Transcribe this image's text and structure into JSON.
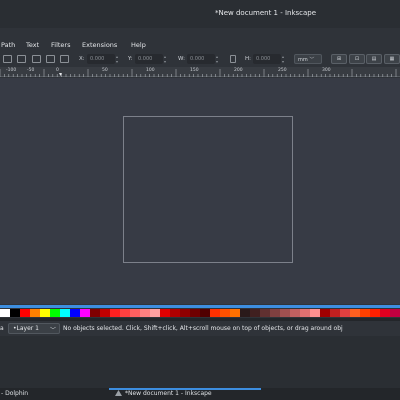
{
  "window": {
    "title": "*New document 1 - Inkscape"
  },
  "menu": {
    "items": [
      "Path",
      "Text",
      "Filters",
      "Extensions",
      "Help"
    ]
  },
  "toolbar": {
    "x_label": "X:",
    "x_value": "0.000",
    "y_label": "Y:",
    "y_value": "0.000",
    "w_label": "W:",
    "w_value": "0.000",
    "h_label": "H:",
    "h_value": "0.000",
    "unit": "mm"
  },
  "ruler": {
    "labels": [
      "-100",
      "-50",
      "0",
      "50",
      "100",
      "150",
      "200",
      "250",
      "300"
    ]
  },
  "palette": {
    "colors": [
      "#ffffff",
      "#000000",
      "#ff0000",
      "#ff8000",
      "#ffff00",
      "#00ff00",
      "#00ffff",
      "#0000ff",
      "#ff00ff",
      "#800000",
      "#c00000",
      "#ff2020",
      "#ff4040",
      "#ff6060",
      "#ff8080",
      "#ffa0a0",
      "#e00000",
      "#b00000",
      "#900000",
      "#700000",
      "#500000",
      "#ff3000",
      "#ff5000",
      "#ff7000",
      "#2a1a1a",
      "#402020",
      "#603030",
      "#804040",
      "#a05050",
      "#c06060",
      "#e07070",
      "#ff9090",
      "#a00000",
      "#c02020",
      "#e04040",
      "#ff6020",
      "#ff4000",
      "#ff2000",
      "#e00020",
      "#c00040"
    ]
  },
  "status": {
    "layer": "•Layer 1",
    "message": "No objects selected. Click, Shift+click, Alt+scroll mouse on top of objects, or drag around obj"
  },
  "taskbar": {
    "dolphin": "- Dolphin",
    "inkscape": "*New document 1 - Inkscape"
  }
}
